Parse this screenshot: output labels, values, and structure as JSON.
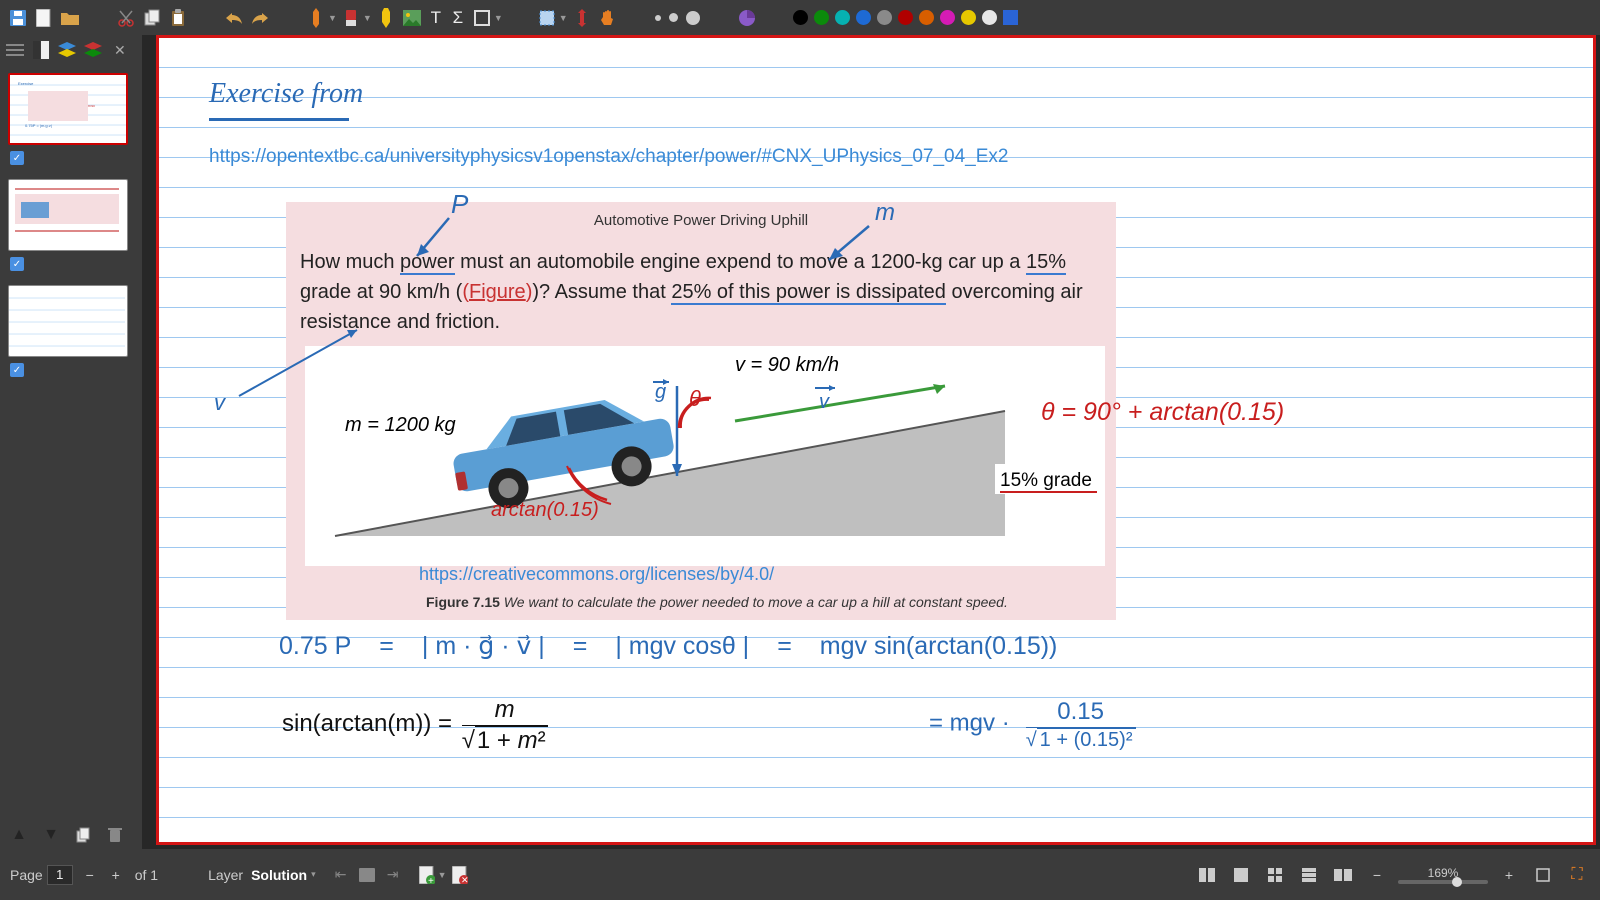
{
  "toolbar": {
    "tools": [
      "save",
      "new-page",
      "open",
      "cut",
      "copy",
      "paste",
      "undo",
      "redo",
      "pen",
      "eraser",
      "highlighter",
      "image",
      "text",
      "math",
      "shape",
      "select",
      "vert-space",
      "hand"
    ],
    "text_T": "T",
    "text_Sigma": "Σ"
  },
  "colors": {
    "palette": [
      "#000",
      "#0b8a0b",
      "#06b1b1",
      "#1e6ad4",
      "#8a8a8a",
      "#b00000",
      "#d85e00",
      "#d51bb5",
      "#e6c800",
      "#e6e6e6",
      "#2a64d6"
    ]
  },
  "sidebar": {
    "checked": true
  },
  "page": {
    "title": "Exercise from",
    "url1": "https://opentextbc.ca/universityphysicsv1openstax/chapter/power/#CNX_UPhysics_07_04_Ex2",
    "url2": "https://creativecommons.org/licenses/by/4.0/",
    "problem": {
      "heading": "Automotive Power Driving Uphill",
      "text_pre": "How much ",
      "power": "power",
      "text_mid1": " must an automobile engine expend to move a 1200-kg car up a ",
      "grade15": "15%",
      "text_mid2": " grade at 90 km/h (",
      "fig_paren_open": "(",
      "figure": "Figure",
      "fig_paren_close": ")",
      "text_mid3": ")? Assume that ",
      "dissipated": "25% of this power is dissipated",
      "text_end": " overcoming air resistance and friction."
    },
    "diagram": {
      "v_label": "v = 90 km/h",
      "m_label": "m = 1200 kg",
      "grade_label": "15% grade",
      "caption_bold": "Figure 7.15",
      "caption_text": " We want to calculate the power needed to move a car up a hill at constant speed."
    },
    "annotations": {
      "P": "P",
      "m": "m",
      "v": "v",
      "g_vec": "g",
      "theta": "θ",
      "v_vec": "v",
      "arctan": "arctan(0.15)",
      "theta_eq": "θ = 90° + arctan(0.15)"
    },
    "equations": {
      "e1_a": "0.75 P",
      "e1_eq": "=",
      "e1_b": "| m · g⃗ · v⃗ |",
      "e1_c": "| mgv cosθ |",
      "e1_d": "mgv sin(arctan(0.15))",
      "formula_lhs": "sin(arctan(m)) = ",
      "formula_num": "m",
      "formula_den": "√(1 + m²)",
      "e2_a": "= mgv ·",
      "e2_num": "0.15",
      "e2_den": "√(1 + (0.15)²)"
    }
  },
  "status": {
    "page_label": "Page",
    "page_num": "1",
    "of": "of 1",
    "layer_label": "Layer",
    "layer_value": "Solution",
    "zoom": "169%"
  }
}
